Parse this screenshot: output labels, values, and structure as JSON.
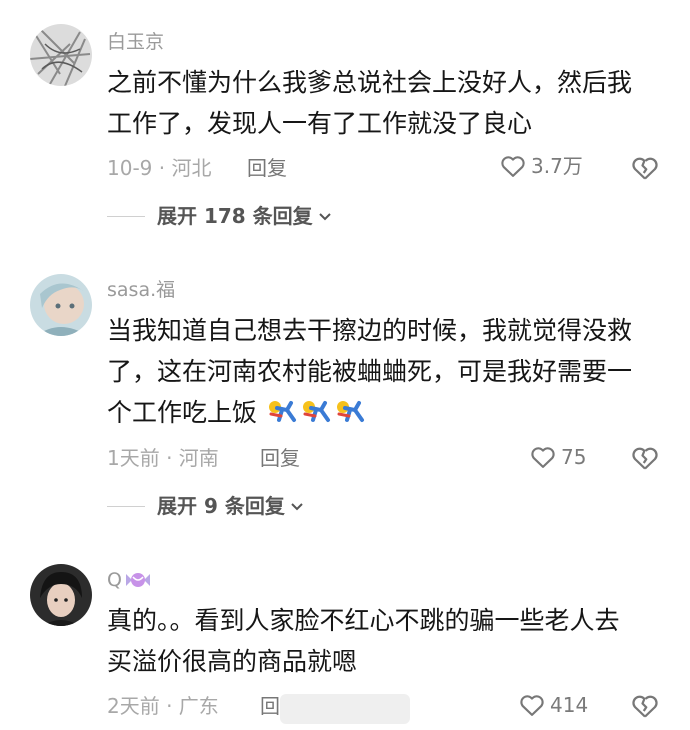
{
  "comments": [
    {
      "username": "白玉京",
      "lines": [
        "之前不懂为什么我爹总说社会上没好人，然后我",
        "工作了，发现人一有了工作就没了良心"
      ],
      "meta": "10-9 · 河北",
      "reply": "回复",
      "likes": "3.7万",
      "expand": "展开 178 条回复"
    },
    {
      "username": "sasa.福",
      "lines": [
        "当我知道自己想去干擦边的时候，我就觉得没救",
        "了，这在河南农村能被蛐蛐死，可是我好需要一",
        "个工作吃上饭"
      ],
      "meta": "1天前 · 河南",
      "reply": "回复",
      "likes": "75",
      "expand": "展开 9 条回复"
    },
    {
      "username": "Q",
      "lines": [
        "真的。。看到人家脸不红心不跳的骗一些老人去",
        "买溢价很高的商品就嗯"
      ],
      "meta": "2天前 · 广东",
      "reply": "回",
      "likes": "414"
    }
  ],
  "colors": {
    "text": "#161616",
    "secondary": "#9a9a9a",
    "background": "#ffffff"
  },
  "icons": {
    "like": "heart-outline-icon",
    "dislike": "broken-heart-icon",
    "expand": "chevron-down-icon",
    "emoji": "running-emoji-icon",
    "candy": "candy-icon"
  }
}
